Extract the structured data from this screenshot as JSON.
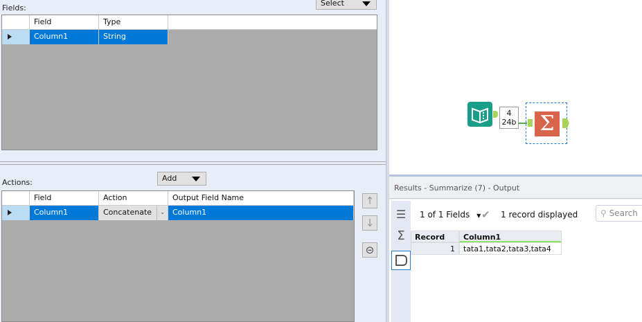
{
  "fields": {
    "label": "Fields:",
    "select_label": "Select",
    "columns": [
      "Field",
      "Type"
    ],
    "rows": [
      {
        "field": "Column1",
        "type": "String"
      }
    ]
  },
  "actions": {
    "label": "Actions:",
    "add_label": "Add",
    "columns": [
      "Field",
      "Action",
      "Output Field Name"
    ],
    "rows": [
      {
        "field": "Column1",
        "action": "Concatenate",
        "output": "Column1"
      }
    ]
  },
  "canvas": {
    "connection_records": "4",
    "connection_size": "24b",
    "colors": {
      "input_tool": "#1a9e8a",
      "summarize_tool": "#d9644c",
      "anchor": "#a9d35a"
    }
  },
  "results": {
    "title": "Results - Summarize (7) - Output",
    "fields_selector": "1 of 1 Fields",
    "status": "1 record displayed",
    "search_placeholder": "Search",
    "columns": [
      "Record",
      "Column1"
    ],
    "rows": [
      {
        "record": "1",
        "column1": "tata1,tata2,tata3,tata4"
      }
    ]
  }
}
